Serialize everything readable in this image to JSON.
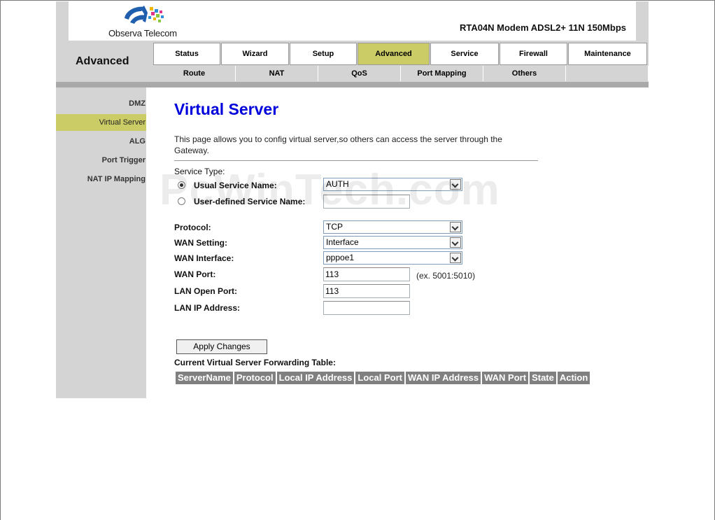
{
  "brand": {
    "name": "Observa Telecom"
  },
  "model": "RTA04N Modem ADSL2+ 11N 150Mbps",
  "section_title": "Advanced",
  "main_tabs": [
    {
      "label": "Status"
    },
    {
      "label": "Wizard"
    },
    {
      "label": "Setup"
    },
    {
      "label": "Advanced"
    },
    {
      "label": "Service"
    },
    {
      "label": "Firewall"
    },
    {
      "label": "Maintenance"
    }
  ],
  "sub_tabs": [
    {
      "label": "Route"
    },
    {
      "label": "NAT"
    },
    {
      "label": "QoS"
    },
    {
      "label": "Port Mapping"
    },
    {
      "label": "Others"
    }
  ],
  "sidebar": {
    "items": [
      {
        "label": "DMZ"
      },
      {
        "label": "Virtual Server"
      },
      {
        "label": "ALG"
      },
      {
        "label": "Port Trigger"
      },
      {
        "label": "NAT IP Mapping"
      }
    ]
  },
  "page": {
    "title": "Virtual Server",
    "description": "This page allows you to config virtual server,so others can access the server through the Gateway."
  },
  "form": {
    "service_type_label": "Service Type:",
    "usual_service_label": "Usual Service Name:",
    "usual_service_value": "AUTH",
    "user_defined_label": "User-defined Service Name:",
    "user_defined_value": "",
    "protocol_label": "Protocol:",
    "protocol_value": "TCP",
    "wan_setting_label": "WAN Setting:",
    "wan_setting_value": "Interface",
    "wan_interface_label": "WAN Interface:",
    "wan_interface_value": "pppoe1",
    "wan_port_label": "WAN Port:",
    "wan_port_value": "113",
    "wan_port_hint": "(ex. 5001:5010)",
    "lan_open_port_label": "LAN Open Port:",
    "lan_open_port_value": "113",
    "lan_ip_label": "LAN IP Address:",
    "lan_ip_value": "",
    "apply_button": "Apply Changes"
  },
  "table": {
    "title": "Current Virtual Server Forwarding Table:",
    "columns": [
      "ServerName",
      "Protocol",
      "Local IP Address",
      "Local Port",
      "WAN IP Address",
      "WAN Port",
      "State",
      "Action"
    ]
  },
  "watermark": "PcWinTech.com",
  "colors": {
    "active_tab": "#cccc66",
    "title_blue": "#0000dd",
    "header_gray": "#d4d4d4",
    "table_header": "#808080"
  }
}
